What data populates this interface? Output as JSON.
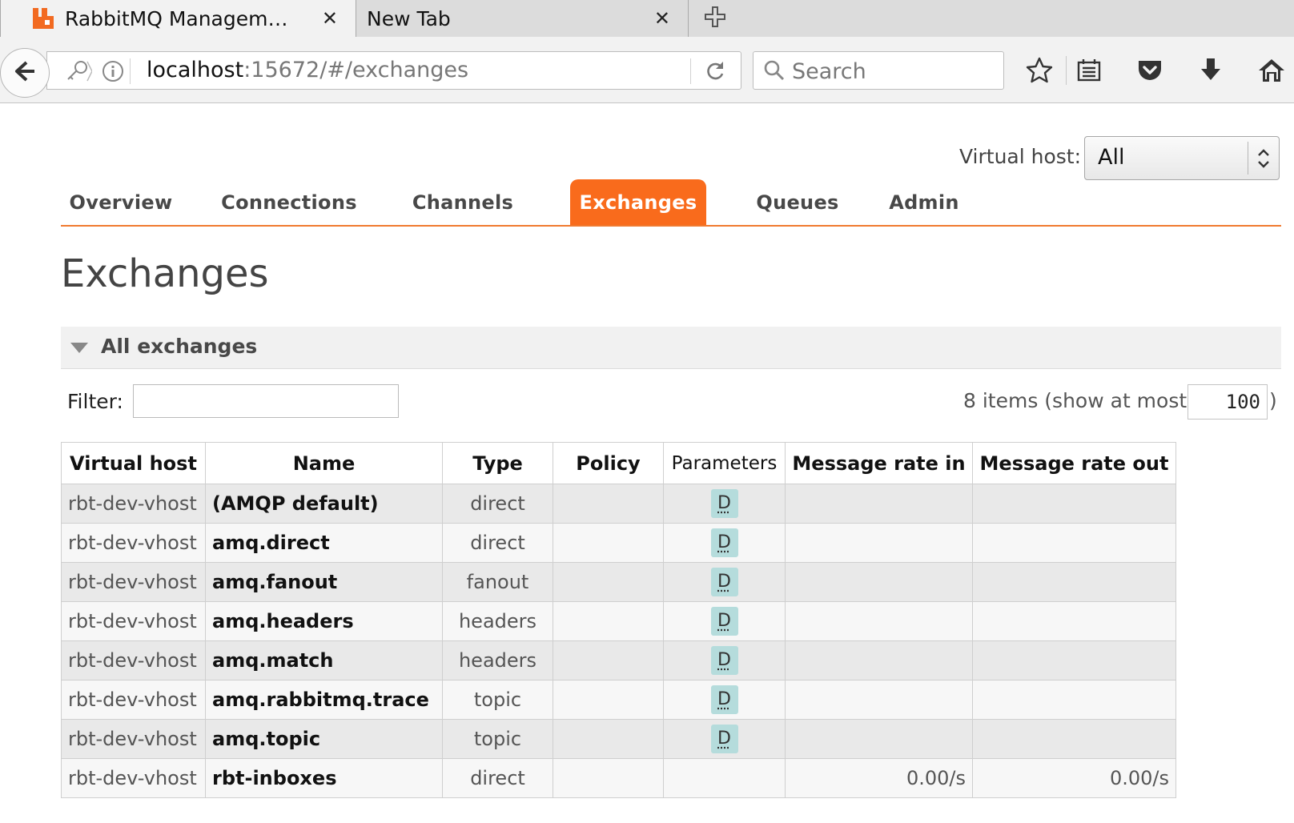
{
  "browser": {
    "tabs": [
      {
        "title": "RabbitMQ Managem…",
        "close": "✕",
        "active": true
      },
      {
        "title": "New Tab",
        "close": "✕",
        "active": false
      }
    ],
    "url_host": "localhost",
    "url_path": ":15672/#/exchanges",
    "search_placeholder": "Search"
  },
  "header": {
    "vhost_label": "Virtual host:",
    "vhost_value": "All"
  },
  "nav": {
    "items": [
      "Overview",
      "Connections",
      "Channels",
      "Exchanges",
      "Queues",
      "Admin"
    ],
    "active": "Exchanges"
  },
  "page": {
    "title": "Exchanges",
    "section_title": "All exchanges",
    "filter_label": "Filter:",
    "items_info": "8 items (show at most",
    "items_limit": "100",
    "items_close": ")"
  },
  "table": {
    "columns": [
      "Virtual host",
      "Name",
      "Type",
      "Policy",
      "Parameters",
      "Message rate in",
      "Message rate out"
    ],
    "rows": [
      {
        "vhost": "rbt-dev-vhost",
        "name": "(AMQP default)",
        "type": "direct",
        "policy": "",
        "params": "D",
        "rate_in": "",
        "rate_out": ""
      },
      {
        "vhost": "rbt-dev-vhost",
        "name": "amq.direct",
        "type": "direct",
        "policy": "",
        "params": "D",
        "rate_in": "",
        "rate_out": ""
      },
      {
        "vhost": "rbt-dev-vhost",
        "name": "amq.fanout",
        "type": "fanout",
        "policy": "",
        "params": "D",
        "rate_in": "",
        "rate_out": ""
      },
      {
        "vhost": "rbt-dev-vhost",
        "name": "amq.headers",
        "type": "headers",
        "policy": "",
        "params": "D",
        "rate_in": "",
        "rate_out": ""
      },
      {
        "vhost": "rbt-dev-vhost",
        "name": "amq.match",
        "type": "headers",
        "policy": "",
        "params": "D",
        "rate_in": "",
        "rate_out": ""
      },
      {
        "vhost": "rbt-dev-vhost",
        "name": "amq.rabbitmq.trace",
        "type": "topic",
        "policy": "",
        "params": "D",
        "rate_in": "",
        "rate_out": ""
      },
      {
        "vhost": "rbt-dev-vhost",
        "name": "amq.topic",
        "type": "topic",
        "policy": "",
        "params": "D",
        "rate_in": "",
        "rate_out": ""
      },
      {
        "vhost": "rbt-dev-vhost",
        "name": "rbt-inboxes",
        "type": "direct",
        "policy": "",
        "params": "",
        "rate_in": "0.00/s",
        "rate_out": "0.00/s"
      }
    ]
  },
  "colors": {
    "accent": "#f96b1c",
    "badge": "#b5dcdc"
  },
  "icons": {
    "favicon": "rabbitmq-icon",
    "back": "back-arrow-icon",
    "key": "key-icon",
    "info": "info-icon",
    "reload": "reload-icon",
    "search": "search-icon",
    "bookmark": "star-icon",
    "reading_list": "reading-list-icon",
    "pocket": "pocket-icon",
    "download": "download-icon",
    "home": "home-icon",
    "new_tab": "plus-icon"
  }
}
